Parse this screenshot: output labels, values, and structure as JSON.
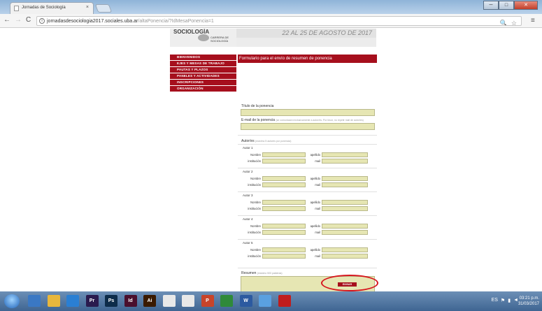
{
  "browser": {
    "tab_title": "Jornadas de Sociología",
    "tab_close": "×",
    "url_host": "jornadasdesociologia2017.sociales.uba.ar",
    "url_path": "/altaPonencia/?IdMesaPonencia=1",
    "nav_back": "←",
    "nav_forward": "→",
    "nav_reload": "C",
    "info_icon": "i",
    "zoom_icon": "🔍",
    "star_icon": "☆",
    "menu_icon": "≡",
    "window_buttons": [
      "─",
      "□",
      "✕"
    ]
  },
  "header": {
    "logo_word": "SOCIOLOGÍA",
    "logo_subtitle": "CARRERA DE SOCIOLOGÍA",
    "banner_text": "22 AL 25 DE AGOSTO DE 2017"
  },
  "sidebar": {
    "items": [
      {
        "label": "BIENVENIDOS"
      },
      {
        "label": "EJES Y MESAS DE TRABAJO"
      },
      {
        "label": "PAUTAS Y PLAZOS"
      },
      {
        "label": "PANELES Y ACTIVIDADES"
      },
      {
        "label": "INSCRIPCIONES"
      },
      {
        "label": "ORGANIZACIÓN"
      }
    ]
  },
  "form": {
    "header_title": "Formulario para el envío de resumen de ponencia",
    "title_label": "Título de la ponencia",
    "email_label": "E-mail de la ponencia",
    "email_hint": "(se comunicará exclusivamente a autor/es. Por favor, no repetir mail de autor/es)",
    "authors_label": "Autor/es",
    "authors_hint": "(máximo 5 autores por ponencia)",
    "authors": [
      {
        "title": "Autor 1",
        "nombre": "Nombre",
        "apellido": "apellido",
        "institucion": "institución",
        "mail": "mail"
      },
      {
        "title": "Autor 2",
        "nombre": "Nombre",
        "apellido": "apellido",
        "institucion": "institución",
        "mail": "mail"
      },
      {
        "title": "Autor 3",
        "nombre": "Nombre",
        "apellido": "apellido",
        "institucion": "institución",
        "mail": "mail"
      },
      {
        "title": "Autor 4",
        "nombre": "Nombre",
        "apellido": "apellido",
        "institucion": "institución",
        "mail": "mail"
      },
      {
        "title": "Autor 5",
        "nombre": "Nombre",
        "apellido": "apellido",
        "institucion": "institución",
        "mail": "mail"
      }
    ],
    "resumen_label": "Resumen",
    "resumen_hint": "(máximo 500 palabras)",
    "submit_label": "ENVIAR"
  },
  "taskbar": {
    "apps": [
      "",
      "",
      "",
      "Pr",
      "Ps",
      "Id",
      "Ai",
      "",
      "",
      "P",
      "",
      "W",
      "",
      ""
    ],
    "app_colors": [
      "#3a78c4",
      "#e8b73c",
      "#2a7fd3",
      "#2a1b4e",
      "#0d2c4a",
      "#4a0f2d",
      "#3a1a00",
      "#e8e8e8",
      "#e8e8e8",
      "#c8442a",
      "#2f8a3a",
      "#2c5aa0",
      "#5aa0e0",
      "#c01c1c"
    ],
    "tray_text": "ES",
    "clock_time": "03:21 p.m.",
    "clock_date": "31/03/2017"
  },
  "colors": {
    "accent": "#a60f1d",
    "field_fill": "#e6e6b3",
    "annotation": "#d6161e"
  }
}
